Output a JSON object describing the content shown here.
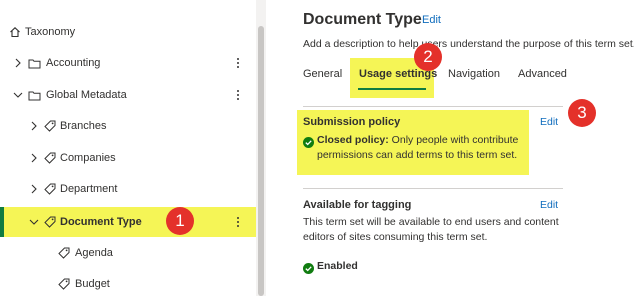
{
  "tree": {
    "items": [
      {
        "label": "Taxonomy",
        "icon": "home-icon"
      },
      {
        "label": "Accounting",
        "icon": "folder-icon"
      },
      {
        "label": "Global Metadata",
        "icon": "folder-icon"
      },
      {
        "label": "Branches",
        "icon": "tag-icon"
      },
      {
        "label": "Companies",
        "icon": "tag-icon"
      },
      {
        "label": "Department",
        "icon": "tag-icon"
      },
      {
        "label": "Document Type",
        "icon": "tag-icon",
        "selected": true
      },
      {
        "label": "Agenda",
        "icon": "tag-icon"
      },
      {
        "label": "Budget",
        "icon": "tag-icon"
      }
    ],
    "highlight_color": "#f5f556",
    "selection_color": "#107c41"
  },
  "detail": {
    "title": "Document Type",
    "title_edit": "Edit",
    "description": "Add a description to help users understand the purpose of this term set.",
    "tabs": [
      "General",
      "Usage settings",
      "Navigation",
      "Advanced"
    ],
    "active_tab": "Usage settings",
    "submission": {
      "heading": "Submission policy",
      "edit": "Edit",
      "policy_name": "Closed policy:",
      "policy_text": " Only people with contribute permissions can add terms to this term set."
    },
    "tagging": {
      "heading": "Available for tagging",
      "edit": "Edit",
      "text": "This term set will be available to end users and content editors of sites consuming this term set.",
      "status": "Enabled"
    },
    "link_color": "#0f6cbd",
    "success_color": "#107c10"
  },
  "callouts": [
    "1",
    "2",
    "3"
  ],
  "callout_color": "#e4312a"
}
